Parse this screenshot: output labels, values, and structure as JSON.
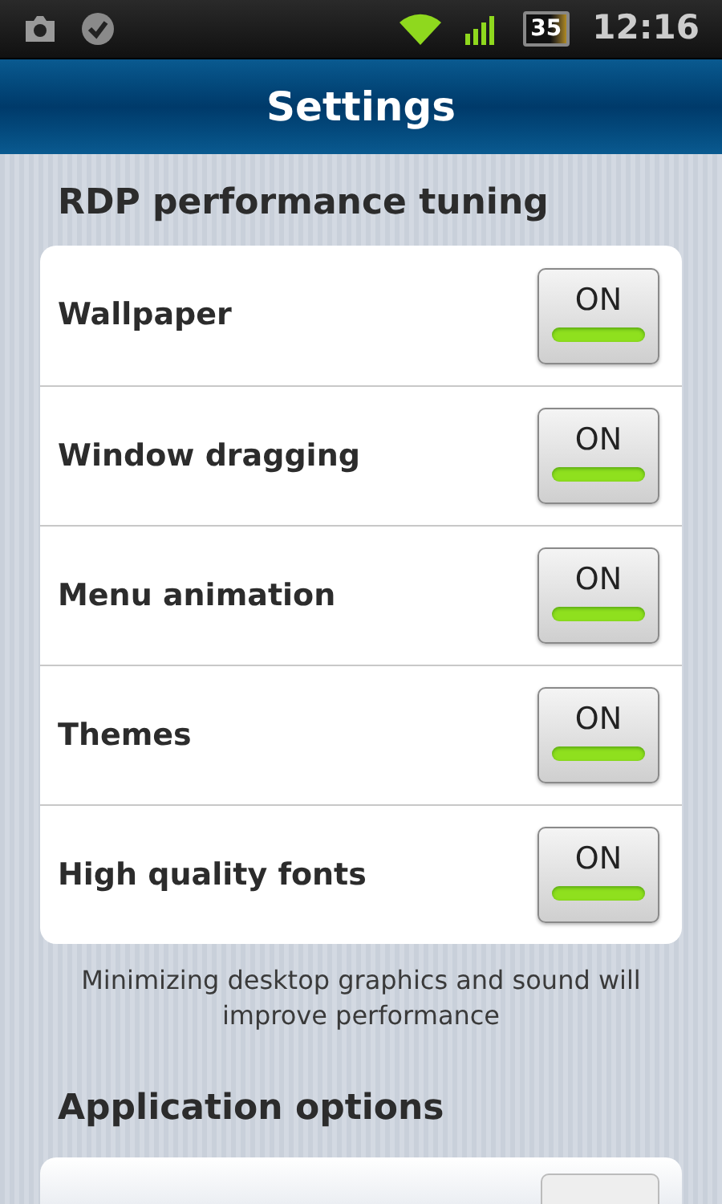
{
  "status_bar": {
    "battery": "35",
    "time": "12:16"
  },
  "header": {
    "title": "Settings"
  },
  "sections": [
    {
      "title": "RDP performance tuning",
      "items": [
        {
          "label": "Wallpaper",
          "toggle": "ON",
          "on": true
        },
        {
          "label": "Window dragging",
          "toggle": "ON",
          "on": true
        },
        {
          "label": "Menu animation",
          "toggle": "ON",
          "on": true
        },
        {
          "label": "Themes",
          "toggle": "ON",
          "on": true
        },
        {
          "label": "High quality fonts",
          "toggle": "ON",
          "on": true
        }
      ],
      "note": "Minimizing desktop graphics and sound will improve performance"
    },
    {
      "title": "Application options"
    }
  ]
}
